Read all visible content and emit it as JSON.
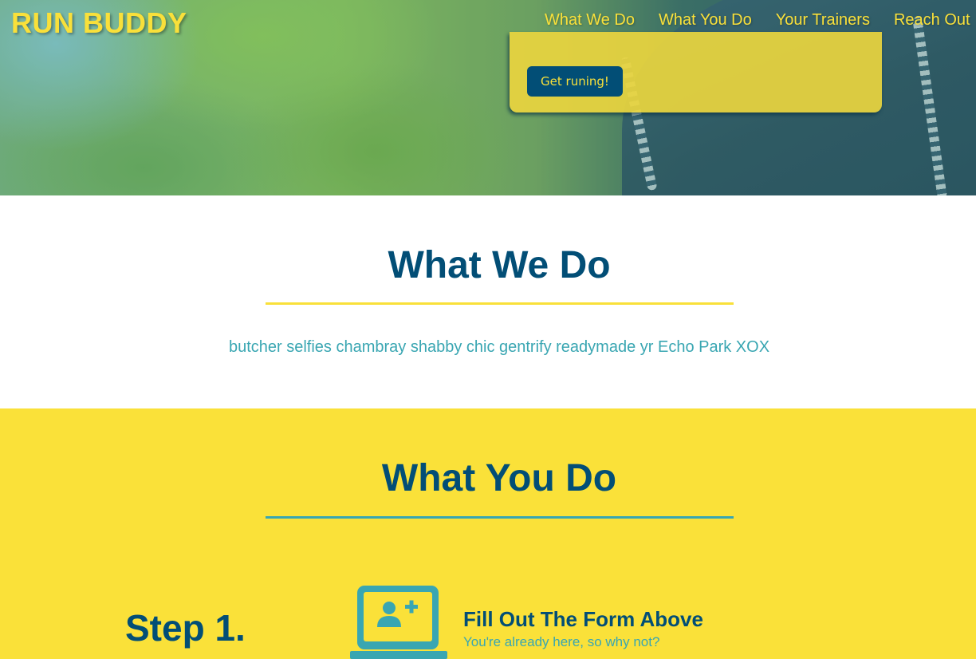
{
  "header": {
    "logo": "RUN BUDDY",
    "nav": [
      {
        "label": "What We Do"
      },
      {
        "label": "What You Do"
      },
      {
        "label": "Your Trainers"
      },
      {
        "label": "Reach Out"
      }
    ]
  },
  "hero": {
    "signup_button": "Get runing!"
  },
  "what_we_do": {
    "title": "What We Do",
    "text": "butcher selfies chambray shabby chic gentrify readymade yr Echo Park XOX"
  },
  "what_you_do": {
    "title": "What You Do",
    "steps": [
      {
        "label": "Step 1.",
        "icon": "computer-add-user-icon",
        "heading": "Fill Out The Form Above",
        "subtext": "You're already here, so why not?"
      }
    ]
  },
  "colors": {
    "primary": "#024e76",
    "accent_yellow": "#fae139",
    "accent_teal": "#39a6b2"
  }
}
